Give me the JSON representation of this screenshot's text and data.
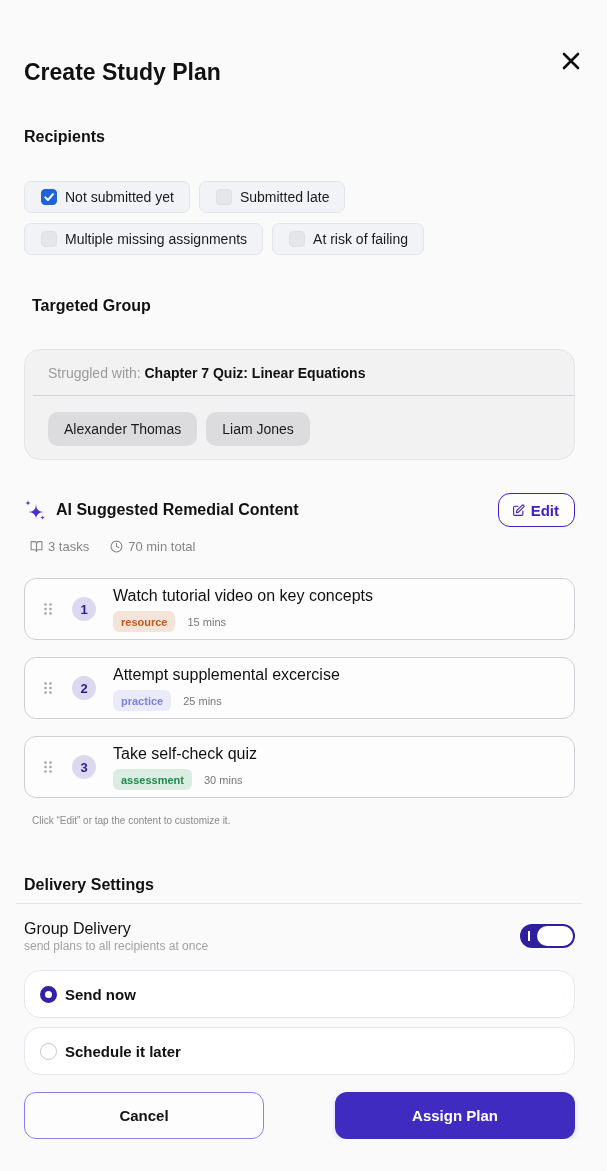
{
  "title": "Create Study Plan",
  "recipients": {
    "heading": "Recipients",
    "options": [
      {
        "label": "Not submitted yet",
        "checked": true
      },
      {
        "label": "Submitted late",
        "checked": false
      },
      {
        "label": "Multiple missing assignments",
        "checked": false
      },
      {
        "label": "At risk of failing",
        "checked": false
      }
    ]
  },
  "targeted_group": {
    "heading": "Targeted Group",
    "struggled_with": "Struggled with: **Chapter 7 Quiz: Linear Equations**",
    "students": [
      "Alexander Thomas",
      "Liam Jones"
    ]
  },
  "remedial": {
    "heading": "AI Suggested Remedial Content",
    "edit_button": "Edit",
    "task_count": "3 tasks",
    "total_time": "70 min total",
    "tasks": [
      {
        "number": "1",
        "title": "Watch tutorial video on key concepts",
        "tag": "resource",
        "color": "#c2591a",
        "duration": "15 mins"
      },
      {
        "number": "2",
        "title": "Attempt supplemental excercise",
        "tag": "practice",
        "color": "#7b7fe0",
        "duration": "25 mins"
      },
      {
        "number": "3",
        "title": "Take self-check quiz",
        "tag": "assessment",
        "color": "#1f8a4a",
        "duration": "30 mins"
      }
    ],
    "hint": "Click “Edit” or tap the content to customize it."
  },
  "delivery": {
    "heading": "Delivery Settings",
    "group_delivery": {
      "label": "Group Delivery",
      "description": "send plans to all recipients at once",
      "on": true
    },
    "options": [
      {
        "label": "Send now",
        "selected": true
      },
      {
        "label": "Schedule it later",
        "selected": false
      }
    ]
  },
  "buttons": {
    "cancel": "Cancel",
    "assign": "Assign Plan"
  }
}
